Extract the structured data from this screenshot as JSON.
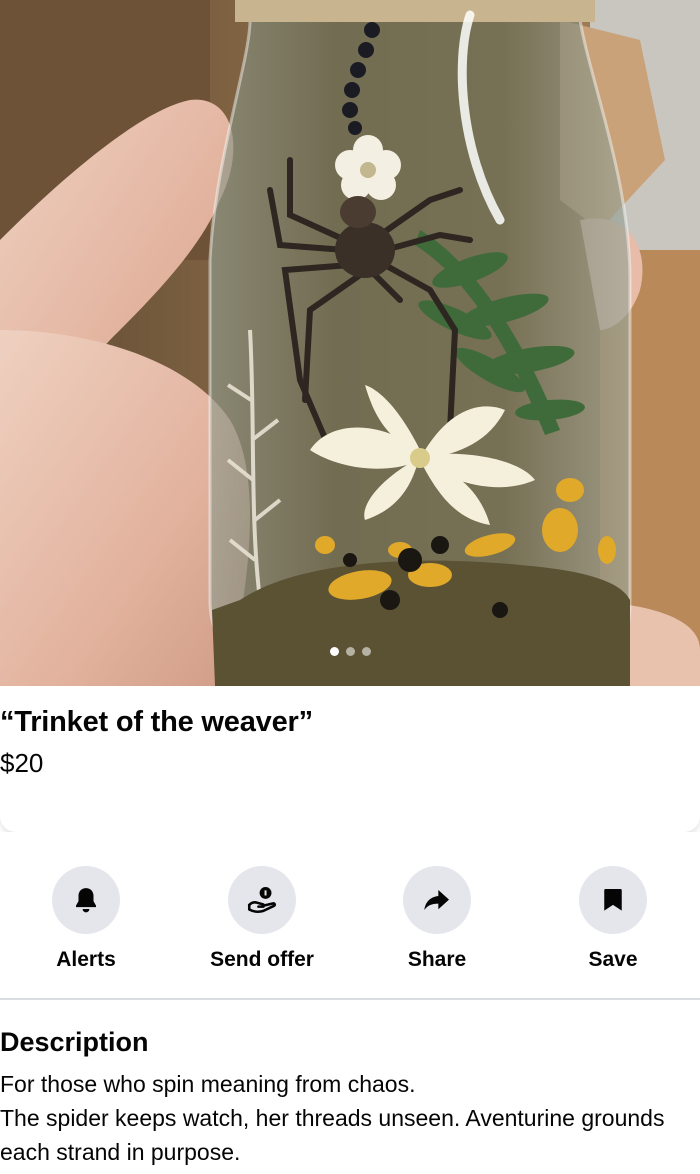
{
  "listing": {
    "title": "“Trinket of the weaver”",
    "price": "$20",
    "photo_count": 3,
    "active_photo_index": 0
  },
  "actions": [
    {
      "label": "Alerts",
      "icon": "bell-icon"
    },
    {
      "label": "Send offer",
      "icon": "offer-hand-icon"
    },
    {
      "label": "Share",
      "icon": "share-arrow-icon"
    },
    {
      "label": "Save",
      "icon": "bookmark-icon"
    }
  ],
  "description": {
    "heading": "Description",
    "lines": [
      "For those who spin meaning from chaos.",
      "The spider keeps watch, her threads unseen. Aventurine grounds each strand in purpose."
    ]
  },
  "colors": {
    "button_bg": "#e4e6eb",
    "text": "#050505",
    "divider": "#dadde1"
  }
}
